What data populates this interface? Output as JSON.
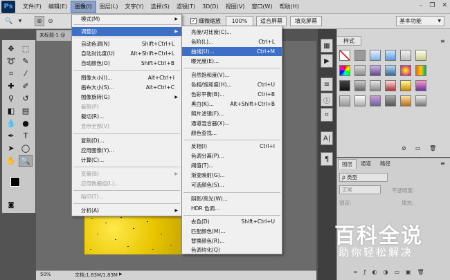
{
  "app": {
    "logo": "Ps",
    "window_controls": [
      "–",
      "❐",
      "✕"
    ]
  },
  "menubar": [
    "文件(F)",
    "编辑(E)",
    "图像(I)",
    "图层(L)",
    "文字(Y)",
    "选择(S)",
    "滤镜(T)",
    "3D(D)",
    "视图(V)",
    "窗口(W)",
    "帮助(H)"
  ],
  "optionsbar": {
    "resize_windows_label": "细微缩放",
    "zoom_value": "100%",
    "fit_screen_label": "适合屏幕",
    "fill_screen_label": "填充屏幕",
    "workspace": "基本功能"
  },
  "document": {
    "tab_title": "未标题-1 @",
    "status_zoom": "50%",
    "status_doc": "文档:1.83M/1.83M"
  },
  "image_menu": [
    {
      "label": "模式(M)",
      "arrow": "▶"
    },
    {
      "label": "调整(J)",
      "arrow": "▶"
    },
    {
      "label": "自动色调(N)",
      "shortcut": "Shift+Ctrl+L"
    },
    {
      "label": "自动对比度(U)",
      "shortcut": "Alt+Shift+Ctrl+L"
    },
    {
      "label": "自动颜色(O)",
      "shortcut": "Shift+Ctrl+B"
    },
    {
      "label": "图像大小(I)...",
      "shortcut": "Alt+Ctrl+I"
    },
    {
      "label": "画布大小(S)...",
      "shortcut": "Alt+Ctrl+C"
    },
    {
      "label": "图像旋转(G)",
      "arrow": "▶"
    },
    {
      "label": "裁剪(P)"
    },
    {
      "label": "裁切(R)..."
    },
    {
      "label": "显示全部(V)"
    },
    {
      "label": "复制(D)..."
    },
    {
      "label": "应用图像(Y)..."
    },
    {
      "label": "计算(C)..."
    },
    {
      "label": "变量(B)",
      "arrow": "▶"
    },
    {
      "label": "应用数据组(L)..."
    },
    {
      "label": "陷印(T)..."
    },
    {
      "label": "分析(A)",
      "arrow": "▶"
    }
  ],
  "adjust_menu": [
    {
      "label": "亮度/对比度(C)..."
    },
    {
      "label": "色阶(L)...",
      "shortcut": "Ctrl+L"
    },
    {
      "label": "曲线(U)...",
      "shortcut": "Ctrl+M"
    },
    {
      "label": "曝光度(E)..."
    },
    {
      "label": "自然饱和度(V)..."
    },
    {
      "label": "色相/饱和度(H)...",
      "shortcut": "Ctrl+U"
    },
    {
      "label": "色彩平衡(B)...",
      "shortcut": "Ctrl+B"
    },
    {
      "label": "黑白(K)...",
      "shortcut": "Alt+Shift+Ctrl+B"
    },
    {
      "label": "照片滤镜(F)..."
    },
    {
      "label": "通道混合器(X)..."
    },
    {
      "label": "颜色查找..."
    },
    {
      "label": "反相(I)",
      "shortcut": "Ctrl+I"
    },
    {
      "label": "色调分离(P)..."
    },
    {
      "label": "阈值(T)..."
    },
    {
      "label": "渐变映射(G)..."
    },
    {
      "label": "可选颜色(S)..."
    },
    {
      "label": "阴影/高光(W)..."
    },
    {
      "label": "HDR 色调..."
    },
    {
      "label": "去色(D)",
      "shortcut": "Shift+Ctrl+U"
    },
    {
      "label": "匹配颜色(M)..."
    },
    {
      "label": "替换颜色(R)..."
    },
    {
      "label": "色调均化(Q)"
    }
  ],
  "panels": {
    "styles_tab": "样式",
    "layers_tabs": [
      "图层",
      "通道",
      "路径"
    ],
    "layers_kind": "ρ 类型",
    "blend_mode": "正常",
    "opacity_label": "不透明度:",
    "lock_label": "锁定:",
    "fill_label": "填充:"
  },
  "watermark": {
    "title": "百科全说",
    "subtitle": "助你轻松解决"
  }
}
